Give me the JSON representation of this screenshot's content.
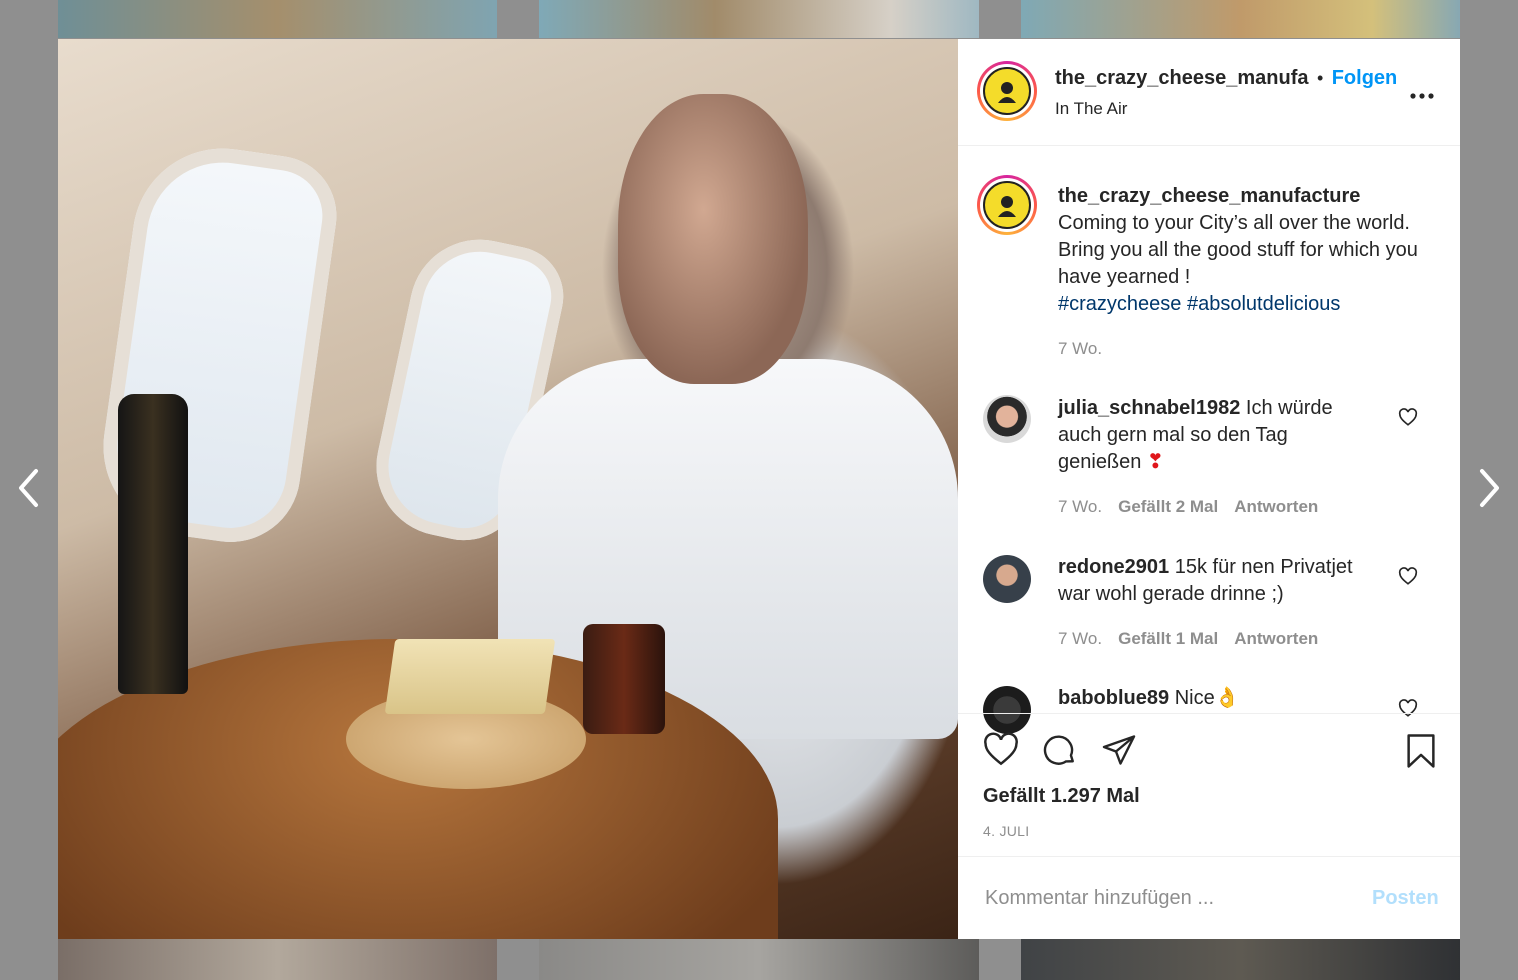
{
  "post": {
    "username": "the_crazy_cheese_manufa",
    "separator": "•",
    "follow_label": "Folgen",
    "location": "In The Air",
    "caption_username": "the_crazy_cheese_manufacture",
    "caption_text": "Coming to your City’s all over the world. Bring you all the good stuff for which you have yearned !",
    "hashtags": [
      "#crazycheese",
      "#absolutdelicious"
    ],
    "caption_age": "7 Wo.",
    "likes_text": "Gefällt 1.297 Mal",
    "date": "4. JULI",
    "comment_placeholder": "Kommentar hinzufügen ...",
    "post_label": "Posten"
  },
  "comments": [
    {
      "username": "julia_schnabel1982",
      "text": "Ich würde auch gern mal so den Tag genießen",
      "emoji": "❣",
      "age": "7 Wo.",
      "likes": "Gefällt 2 Mal",
      "reply": "Antworten"
    },
    {
      "username": "redone2901",
      "text": "15k für nen Privatjet war wohl gerade drinne ;)",
      "age": "7 Wo.",
      "likes": "Gefällt 1 Mal",
      "reply": "Antworten"
    },
    {
      "username": "baboblue89",
      "text": "Nice👌"
    }
  ],
  "icons": {
    "more": "more-options-icon",
    "like": "heart-icon",
    "comment": "comment-icon",
    "share": "share-icon",
    "save": "bookmark-icon",
    "prev": "chevron-left-icon",
    "next": "chevron-right-icon"
  },
  "colors": {
    "follow": "#0095f6",
    "hashtag": "#00376b",
    "post_disabled": "#b2dffc",
    "emoji_heart": "#e0161b"
  }
}
